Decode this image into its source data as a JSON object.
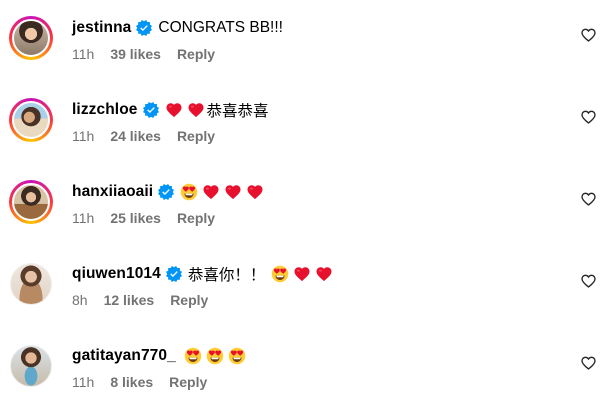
{
  "colors": {
    "verified": "#0095f6",
    "meta_text": "#737373",
    "heart": "#ed4956"
  },
  "comments": [
    {
      "username": "jestinna",
      "verified": true,
      "text": "CONGRATS BB!!!",
      "time": "11h",
      "likes": "39 likes",
      "reply": "Reply",
      "avatar": "avatar-photo"
    },
    {
      "username": "lizzchloe",
      "verified": true,
      "text": "恭喜恭喜",
      "emojis_before": [
        "red-heart",
        "red-heart"
      ],
      "time": "11h",
      "likes": "24 likes",
      "reply": "Reply",
      "avatar": "avatar-photo"
    },
    {
      "username": "hanxiiaoaii",
      "verified": true,
      "text": "",
      "emojis_after": [
        "heart-eyes",
        "red-heart",
        "red-heart",
        "red-heart"
      ],
      "time": "11h",
      "likes": "25 likes",
      "reply": "Reply",
      "avatar": "avatar-photo"
    },
    {
      "username": "qiuwen1014",
      "verified": true,
      "text": "恭喜你！！",
      "emojis_after": [
        "heart-eyes",
        "red-heart",
        "red-heart"
      ],
      "time": "8h",
      "likes": "12 likes",
      "reply": "Reply",
      "avatar": "avatar-photo"
    },
    {
      "username": "gatitayan770_",
      "verified": false,
      "text": "",
      "emojis_after": [
        "heart-eyes",
        "heart-eyes",
        "heart-eyes"
      ],
      "time": "11h",
      "likes": "8 likes",
      "reply": "Reply",
      "avatar": "avatar-photo"
    }
  ]
}
